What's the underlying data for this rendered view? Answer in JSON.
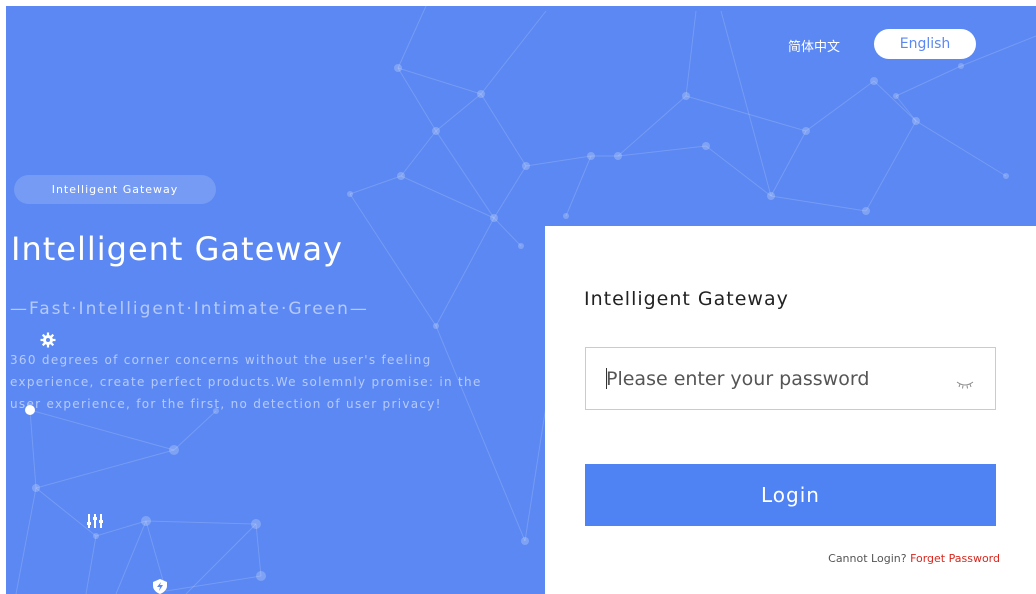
{
  "language_switch": {
    "chinese_label": "简体中文",
    "english_label": "English"
  },
  "hero": {
    "badge": "Intelligent Gateway",
    "title": "Intelligent Gateway",
    "slogan": "—Fast·Intelligent·Intimate·Green—",
    "description": "360 degrees of corner concerns without the user's feeling experience, create perfect products.We solemnly promise: in the user experience, for the first, no detection of user privacy!"
  },
  "login_card": {
    "title": "Intelligent Gateway",
    "password_placeholder": "Please enter your password",
    "password_value": "",
    "login_label": "Login",
    "cannot_login_label": "Cannot Login?",
    "forget_password_label": "Forget Password"
  },
  "icons": [
    "gear-icon",
    "sliders-icon",
    "shield-bolt-icon",
    "eye-closed-icon"
  ],
  "colors": {
    "background": "#5b88f2",
    "login_button": "#4f82f3",
    "forget_link": "#d9261c",
    "card": "#ffffff"
  }
}
